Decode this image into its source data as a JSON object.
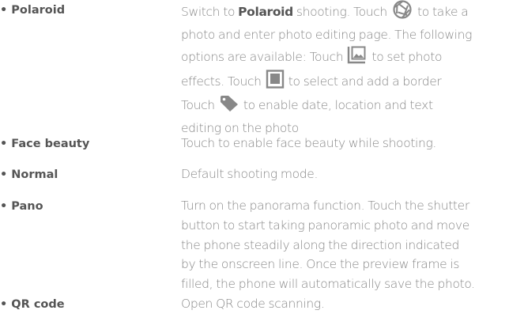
{
  "items": [
    {
      "bullet": "•",
      "term": "Polaroid",
      "desc_line1_a": "Switch to ",
      "desc_line1_bold": "Polaroid",
      "desc_line1_b": " shooting. Touch ",
      "desc_line1_c": " to take a",
      "desc_line2": "photo and enter photo editing page. The following",
      "desc_line3_a": "options are available: Touch ",
      "desc_line3_b": " to set photo",
      "desc_line4_a": "effects. Touch ",
      "desc_line4_b": " to select and add a border",
      "desc_line5_a": "Touch ",
      "desc_line5_b": " to enable date, location and text",
      "desc_line6": "editing on the photo",
      "icons": [
        "shutter-aperture-icon",
        "photo-effects-icon",
        "border-frame-icon",
        "tag-icon"
      ]
    },
    {
      "bullet": "•",
      "term": "Face beauty",
      "desc_line1": "Touch to enable face beauty while shooting."
    },
    {
      "bullet": "•",
      "term": "Normal",
      "desc_line1": "Default shooting mode."
    },
    {
      "bullet": "•",
      "term": "Pano",
      "desc_line1": "Turn on the panorama function. Touch the shutter",
      "desc_line2": "button to start taking panoramic photo and move",
      "desc_line3": "the phone steadily along the direction indicated",
      "desc_line4": "by the onscreen line. Once the preview frame is",
      "desc_line5": "filled, the phone will automatically save the photo."
    },
    {
      "bullet": "•",
      "term": "QR code",
      "desc_line1": "Open QR code scanning."
    }
  ],
  "colors": {
    "term": "#555555",
    "text": "#888888",
    "icon": "#888888"
  }
}
